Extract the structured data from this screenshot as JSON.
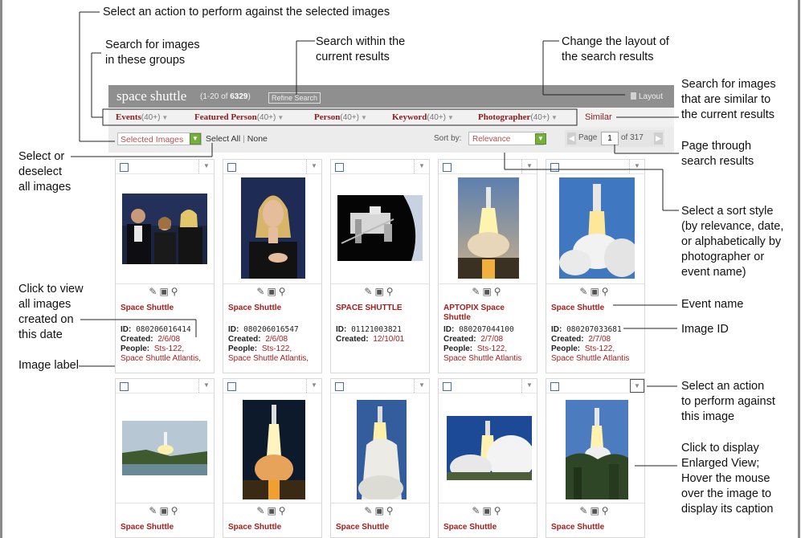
{
  "callouts": {
    "select_action": "Select an action to perform against the selected images",
    "search_groups": "Search for images\nin these groups",
    "search_within": "Search within the\ncurrent results",
    "change_layout": "Change the layout of\nthe search results",
    "search_similar": "Search for images\nthat are similar to\nthe current results",
    "select_deselect": "Select or\ndeselect\nall images",
    "page_through": "Page through\nsearch results",
    "sort_style": "Select a sort style\n(by relevance, date,\nor alphabetically by\nphotographer or\nevent name)",
    "event_name": "Event name",
    "image_id": "Image ID",
    "view_all_date": "Click to view\nall images\ncreated on\nthis date",
    "image_label": "Image label",
    "action_image": "Select an action\nto perform against\nthis image",
    "enlarged_view": "Click to display\nEnlarged View;\nHover the mouse\nover the image to\ndisplay its caption"
  },
  "header": {
    "title": "space shuttle",
    "count_prefix": "(1-20 of ",
    "count_total": "6329",
    "count_suffix": ")",
    "refine": "Refine Search",
    "layout": "Layout"
  },
  "facets": [
    {
      "label": "Events",
      "count": "(40+)"
    },
    {
      "label": "Featured Person",
      "count": "(40+)"
    },
    {
      "label": "Person",
      "count": "(40+)"
    },
    {
      "label": "Keyword",
      "count": "(40+)"
    },
    {
      "label": "Photographer",
      "count": "(40+)"
    }
  ],
  "similar": "Similar",
  "toolbar": {
    "selected_images": "Selected Images",
    "select_all": "Select All",
    "none": "None",
    "sort_by": "Sort by:",
    "sort_value": "Relevance",
    "page_label": "Page",
    "page_value": "1",
    "of_pages": "of 317"
  },
  "cards_row1": [
    {
      "event": "Space Shuttle",
      "id": "080206016414",
      "created": "2/6/08",
      "people": "Sts-122,",
      "people2": "Space Shuttle Atlantis,"
    },
    {
      "event": "Space Shuttle",
      "id": "080206016547",
      "created": "2/6/08",
      "people": "Sts-122,",
      "people2": "Space Shuttle Atlantis,"
    },
    {
      "event": "SPACE SHUTTLE",
      "id": "01121003821",
      "created": "12/10/01",
      "people": "",
      "people2": ""
    },
    {
      "event": "APTOPIX Space Shuttle",
      "id": "080207044100",
      "created": "2/7/08",
      "people": "Sts-122,",
      "people2": "Space Shuttle Atlantis"
    },
    {
      "event": "Space Shuttle",
      "id": "080207033681",
      "created": "2/7/08",
      "people": "Sts-122,",
      "people2": "Space Shuttle Atlantis"
    }
  ],
  "cards_row2": [
    {
      "event": "Space Shuttle"
    },
    {
      "event": "Space Shuttle"
    },
    {
      "event": "Space Shuttle"
    },
    {
      "event": "Space Shuttle"
    },
    {
      "event": "Space Shuttle"
    }
  ],
  "labels": {
    "id": "ID:",
    "created": "Created:",
    "people": "People:"
  },
  "icons": {
    "edit": "edit-icon",
    "save": "save-icon",
    "zoom": "zoom-icon"
  }
}
